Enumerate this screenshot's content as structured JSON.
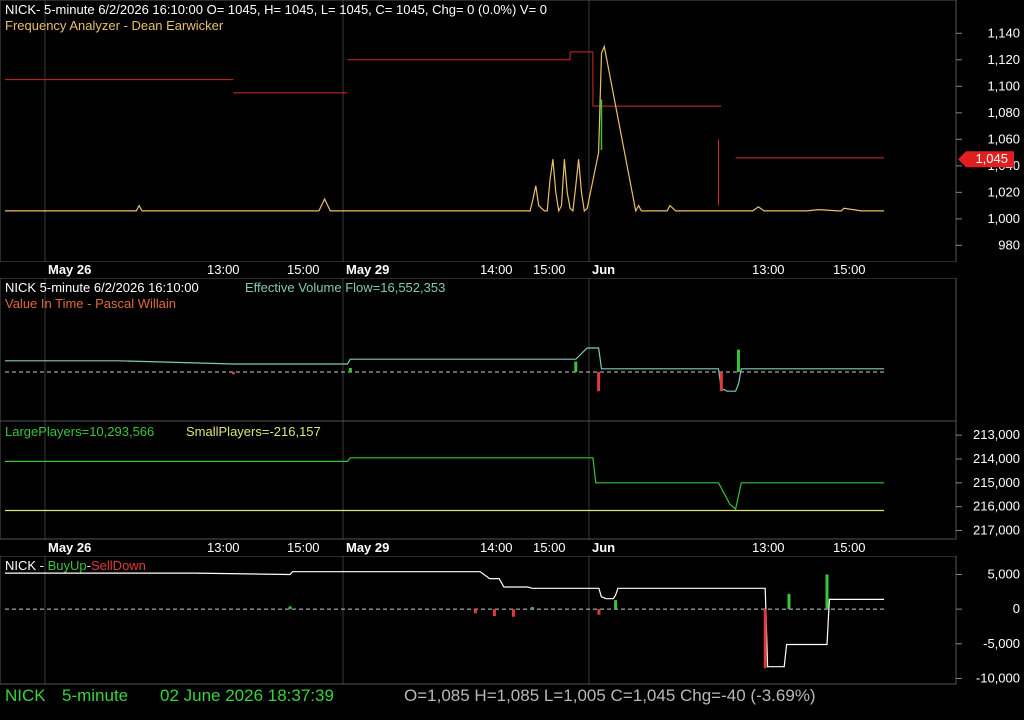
{
  "header": {
    "quote_line": "NICK- 5-minute 6/2/2026 16:10:00 O= 1045, H= 1045, L= 1045, C= 1045, Chg= 0 (0.0%) V= 0",
    "indicator": "Frequency Analyzer - Dean Earwicker"
  },
  "panel2": {
    "quote_line": "NICK 5-minute  6/2/2026 16:10:00",
    "indicator_value": "Effective Volume Flow=16,552,353",
    "indicator": "Value In Time - Pascal Willain"
  },
  "panel3": {
    "large_players": "LargePlayers=10,293,566",
    "small_players": "SmallPlayers=-216,157"
  },
  "panel4": {
    "symbol": "NICK - ",
    "buyup": "BuyUp",
    "dash": "-",
    "selldown": "SellDown"
  },
  "status": {
    "symbol": "NICK",
    "interval": "5-minute",
    "datetime": "02 June 2026 18:37:39",
    "ohlc": "O=1,085  H=1,085  L=1,005  C=1,045  Chg=-40 (-3.69%)"
  },
  "colors": {
    "background": "#000000",
    "grid": "#3a3a3a",
    "price_line": "#e8c06a",
    "frequency_steps": "#d42a2a",
    "value_flow": "#7fc9c0",
    "large_players": "#39c439",
    "small_players": "#e0e07a",
    "buy": "#39c439",
    "sell": "#e23a3a",
    "status_green": "#39d439",
    "status_gray": "#b8b8b8"
  },
  "chart_data": [
    {
      "type": "line",
      "panel": "price",
      "y_ticks": [
        "1,140",
        "1,120",
        "1,100",
        "1,080",
        "1,060",
        "1,040",
        "1,020",
        "1,000",
        "980"
      ],
      "ylim": [
        975,
        1150
      ],
      "last_price_label": "1,045",
      "x_tick_labels_bold": [
        "May 26",
        "May 29",
        "Jun"
      ],
      "x_tick_labels": [
        "13:00",
        "15:00",
        "14:00",
        "15:00",
        "13:00",
        "15:00"
      ],
      "series": [
        {
          "role": "price",
          "x": [
            0,
            40,
            46,
            47,
            48,
            110,
            112,
            114,
            116,
            170,
            172,
            174,
            184,
            185,
            186,
            187,
            188,
            189,
            190,
            191,
            192,
            193,
            194,
            195,
            196,
            197,
            198,
            199,
            200,
            201,
            202,
            203,
            204,
            208,
            209,
            210,
            221,
            222,
            223,
            230,
            231,
            232,
            233,
            235,
            236,
            262,
            264,
            266,
            281,
            285,
            292,
            293,
            294,
            300,
            308
          ],
          "y": [
            1006,
            1006,
            1006,
            1010,
            1006,
            1006,
            1015,
            1006,
            1006,
            1006,
            1006,
            1006,
            1006,
            1015,
            1025,
            1010,
            1008,
            1006,
            1006,
            1030,
            1045,
            1020,
            1006,
            1010,
            1045,
            1020,
            1008,
            1006,
            1025,
            1045,
            1020,
            1006,
            1008,
            1050,
            1125,
            1130,
            1006,
            1010,
            1006,
            1006,
            1006,
            1006,
            1010,
            1006,
            1006,
            1006,
            1009,
            1006,
            1006,
            1007,
            1006,
            1006,
            1008,
            1006,
            1006
          ]
        },
        {
          "role": "frequency_steps",
          "segments": [
            {
              "x0": 0,
              "x1": 80,
              "y": 1105
            },
            {
              "x0": 80,
              "x1": 120,
              "y": 1095
            },
            {
              "x0": 120,
              "x1": 198,
              "y": 1120
            },
            {
              "x0": 198,
              "x1": 206,
              "y": 1126
            },
            {
              "x0": 206,
              "x1": 251,
              "y": 1085
            },
            {
              "x0": 256,
              "x1": 308,
              "y": 1046
            }
          ]
        }
      ]
    },
    {
      "type": "line",
      "panel": "value_in_time",
      "ylim": [
        -6,
        9
      ],
      "series": [
        {
          "role": "effective_volume_flow",
          "x": [
            0,
            40,
            80,
            120,
            121,
            200,
            204,
            208,
            209,
            222,
            230,
            250,
            251,
            252,
            253,
            256,
            257,
            258,
            308
          ],
          "y": [
            1.4,
            1.4,
            1.0,
            1.0,
            1.6,
            1.6,
            3.0,
            3.0,
            0.4,
            0.4,
            0.4,
            0.4,
            -2.2,
            -2.2,
            -2.4,
            -2.4,
            -1.5,
            0.4,
            0.4
          ]
        },
        {
          "role": "impulse_bars",
          "bars": [
            {
              "x": 80,
              "v": -0.3
            },
            {
              "x": 121,
              "v": 0.5
            },
            {
              "x": 200,
              "v": 1.3
            },
            {
              "x": 208,
              "v": -2.4
            },
            {
              "x": 251,
              "v": -2.4
            },
            {
              "x": 257,
              "v": 2.8
            }
          ]
        }
      ]
    },
    {
      "type": "line",
      "panel": "players",
      "y_ticks": [
        "213,000",
        "214,000",
        "215,000",
        "216,000",
        "217,000"
      ],
      "ylim": [
        -217400,
        -212700
      ],
      "series": [
        {
          "name": "LargePlayers",
          "x": [
            0,
            120,
            121,
            206,
            207,
            250,
            254,
            256,
            258,
            308
          ],
          "y": [
            -214100,
            -214100,
            -213950,
            -213950,
            -215000,
            -215000,
            -215900,
            -216100,
            -215000,
            -215000
          ]
        },
        {
          "name": "SmallPlayers",
          "x": [
            0,
            308
          ],
          "y": [
            -216160,
            -216160
          ]
        }
      ]
    },
    {
      "type": "line",
      "panel": "buyup_selldown",
      "y_ticks": [
        "5,000",
        "0",
        "-5,000",
        "-10,000"
      ],
      "ylim": [
        -10800,
        6800
      ],
      "series": [
        {
          "role": "buyup_selldown_line",
          "x": [
            0,
            80,
            120,
            121,
            200,
            204,
            208,
            210,
            220,
            222,
            230,
            250,
            251,
            253,
            256,
            257,
            258,
            320,
            321,
            328,
            329,
            346,
            347,
            370
          ],
          "y": [
            5200,
            5200,
            5000,
            5400,
            5400,
            4400,
            4400,
            3200,
            3200,
            3000,
            3000,
            3000,
            1800,
            1500,
            1500,
            2000,
            3000,
            3000,
            -8300,
            -8300,
            -5100,
            -5100,
            1400,
            1400
          ]
        },
        {
          "role": "impulse_bars",
          "bars": [
            {
              "x": 120,
              "v": 400
            },
            {
              "x": 198,
              "v": -600
            },
            {
              "x": 206,
              "v": -1000
            },
            {
              "x": 214,
              "v": -1100
            },
            {
              "x": 222,
              "v": 300
            },
            {
              "x": 250,
              "v": -800
            },
            {
              "x": 257,
              "v": 1300
            },
            {
              "x": 320,
              "v": -8500
            },
            {
              "x": 330,
              "v": 2200
            },
            {
              "x": 346,
              "v": 5000
            }
          ]
        }
      ]
    }
  ]
}
